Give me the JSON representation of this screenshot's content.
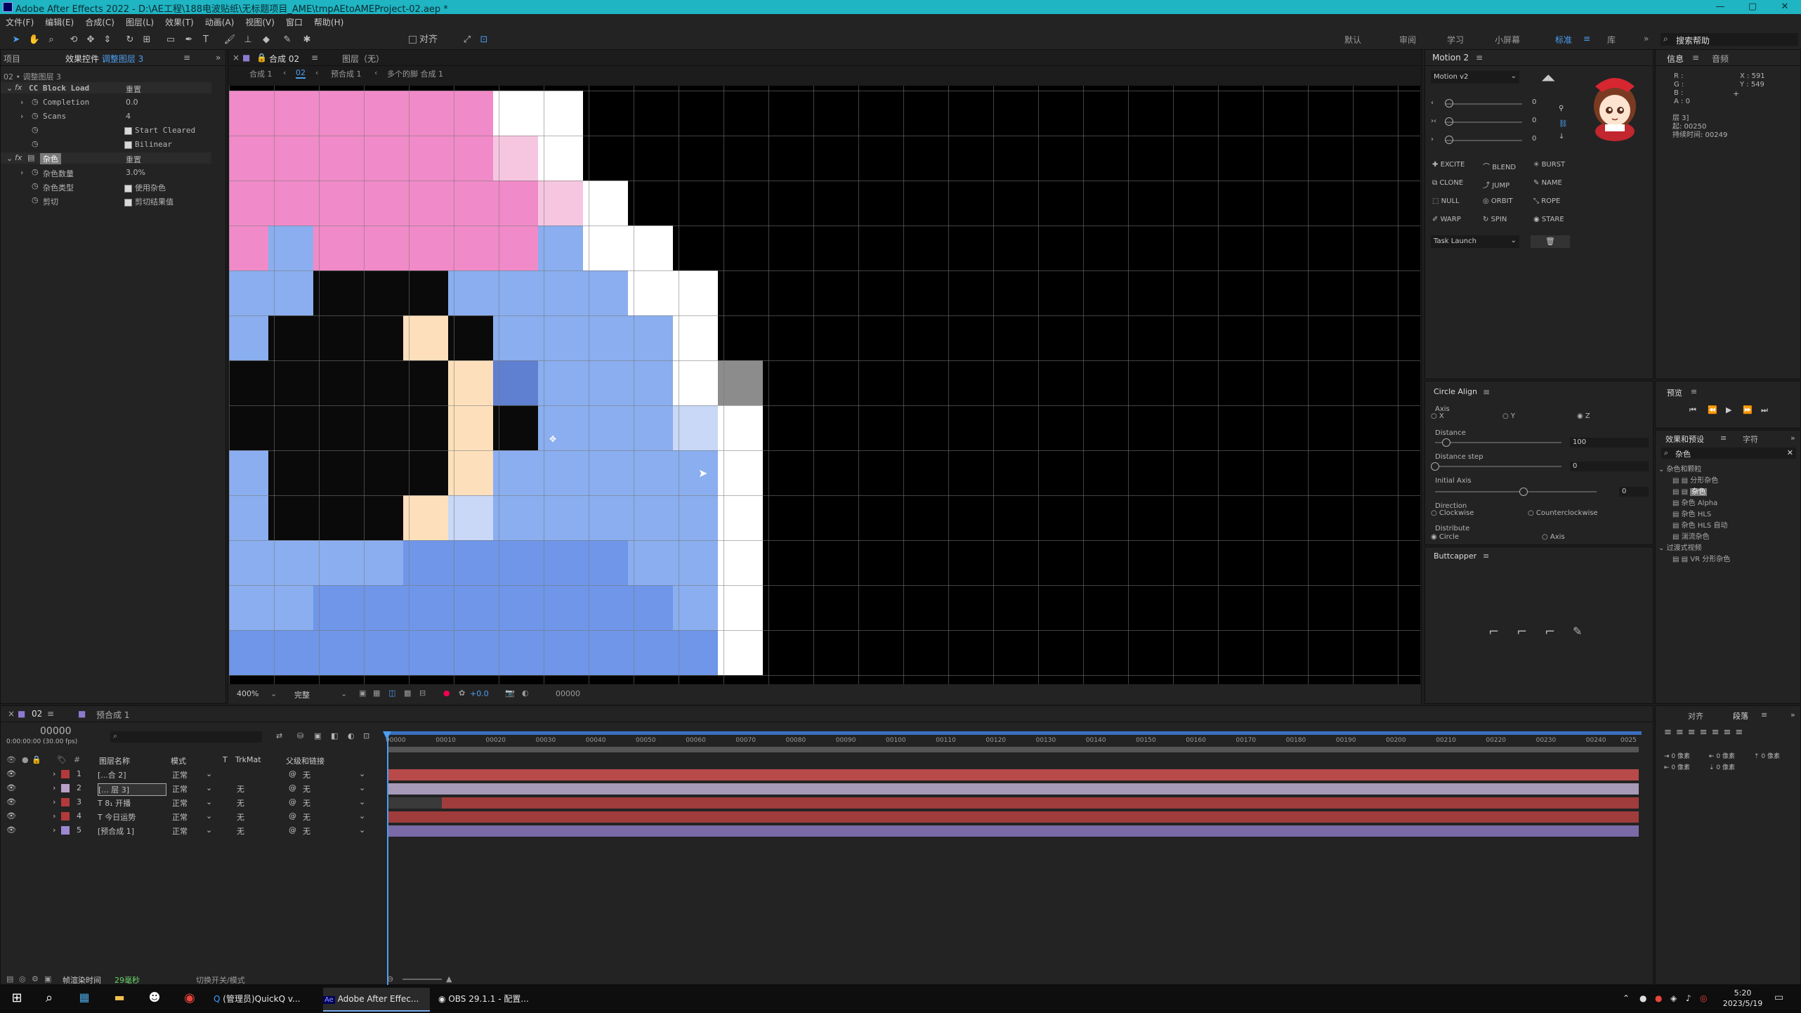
{
  "window": {
    "title": "Adobe After Effects 2022 - D:\\AE工程\\188电波贴纸\\无标题项目_AME\\tmpAEtoAMEProject-02.aep *",
    "controls": [
      "—",
      "▢",
      "✕"
    ]
  },
  "menu": [
    "文件(F)",
    "编辑(E)",
    "合成(C)",
    "图层(L)",
    "效果(T)",
    "动画(A)",
    "视图(V)",
    "窗口",
    "帮助(H)"
  ],
  "toolbar": {
    "align_label": "对齐",
    "workspaces": [
      "默认",
      "审阅",
      "学习",
      "小屏幕",
      "标准",
      "库"
    ],
    "active_workspace": "标准",
    "search_placeholder": "搜索帮助"
  },
  "left_panel": {
    "tab_project": "项目",
    "tab_effects": "效果控件",
    "tab_effects_target": "调整图层 3",
    "subtitle": "02 • 调整图层 3",
    "effect1": {
      "name": "CC Block Load",
      "reset": "重置",
      "props": [
        {
          "name": "Completion",
          "value": "0.0"
        },
        {
          "name": "Scans",
          "value": "4"
        }
      ],
      "checks": [
        "Start Cleared",
        "Bilinear"
      ]
    },
    "effect2": {
      "name": "杂色",
      "reset": "重置",
      "props": [
        {
          "name": "杂色数量",
          "value": "3.0%"
        },
        {
          "name": "杂色类型",
          "value": "使用杂色"
        },
        {
          "name": "剪切",
          "value": "剪切结果值"
        }
      ]
    }
  },
  "comp_panel": {
    "tab_label": "合成 02",
    "layer_tab": "图层（无）",
    "breadcrumbs": [
      "合成 1",
      "02",
      "预合成 1",
      "多个的脚 合成 1"
    ],
    "zoom": "400%",
    "quality": "完整",
    "exposure": "+0.0",
    "timecode": "00000"
  },
  "motion": {
    "title": "Motion 2",
    "version": "Motion v2",
    "sliders": [
      "0",
      "0",
      "0"
    ],
    "buttons": [
      "EXCITE",
      "BLEND",
      "BURST",
      "CLONE",
      "JUMP",
      "NAME",
      "NULL",
      "ORBIT",
      "ROPE",
      "WARP",
      "SPIN",
      "STARE"
    ],
    "task": "Task Launch"
  },
  "circle_align": {
    "title": "Circle Align",
    "axis_label": "Axis",
    "axis_options": [
      "X",
      "Y",
      "Z"
    ],
    "distance_label": "Distance",
    "distance_value": "100",
    "distance_step_label": "Distance step",
    "distance_step_value": "0",
    "initial_axis_label": "Initial Axis",
    "initial_axis_value": "0",
    "direction_label": "Direction",
    "direction_options": [
      "Clockwise",
      "Counterclockwise"
    ],
    "distribute_label": "Distribute",
    "distribute_options": [
      "Circle",
      "Axis"
    ]
  },
  "buttcapper": {
    "title": "Buttcapper"
  },
  "info": {
    "tab_info": "信息",
    "tab_audio": "音频",
    "rgb": [
      "R :",
      "G :",
      "B :",
      "A : 0"
    ],
    "xy": [
      "X : 591",
      "Y : 549"
    ],
    "layer_lines": [
      "层 3]",
      "起: 00250",
      "持续时间: 00249"
    ]
  },
  "preview": {
    "title": "预览"
  },
  "effects_presets": {
    "tab1": "效果和预设",
    "tab2": "字符",
    "search_value": "杂色",
    "groups": [
      {
        "name": "杂色和颗粒",
        "items": [
          "分形杂色",
          "杂色",
          "杂色 Alpha",
          "杂色 HLS",
          "杂色 HLS 自动",
          "湍流杂色"
        ]
      },
      {
        "name": "过渡式视频",
        "items": [
          "VR 分形杂色"
        ]
      }
    ]
  },
  "align_panel": {
    "tab_align": "对齐",
    "tab_paragraph": "段落",
    "values": [
      "0 像素",
      "0 像素",
      "0 像素",
      "0 像素",
      "0 像素"
    ]
  },
  "timeline": {
    "tab_comp": "02",
    "tab_precomp": "预合成 1",
    "timecode": "00000",
    "fps": "0:00:00:00 (30.00 fps)",
    "headers": {
      "name": "图层名称",
      "mode": "模式",
      "t": "T",
      "trkmat": "TrkMat",
      "parent": "父级和链接"
    },
    "ruler": [
      "00000",
      "00010",
      "00020",
      "00030",
      "00040",
      "00050",
      "00060",
      "00070",
      "00080",
      "00090",
      "00100",
      "00110",
      "00120",
      "00130",
      "00140",
      "00150",
      "00160",
      "00170",
      "00180",
      "00190",
      "00200",
      "00210",
      "00220",
      "00230",
      "00240",
      "0025"
    ],
    "layers": [
      {
        "num": "1",
        "name": "[...合 2]",
        "mode": "正常",
        "trkmat": "",
        "parent": "无",
        "label": "#b33a3a",
        "bar": "#b84a4a"
      },
      {
        "num": "2",
        "name": "[... 层 3]",
        "mode": "正常",
        "trkmat": "无",
        "parent": "无",
        "label": "#b8a0c8",
        "bar": "#a79ab8"
      },
      {
        "num": "3",
        "name": "T 8₁ 开播",
        "mode": "正常",
        "trkmat": "无",
        "parent": "无",
        "label": "#b33a3a",
        "bar": "#a03c3c"
      },
      {
        "num": "4",
        "name": "T 今日运势",
        "mode": "正常",
        "trkmat": "无",
        "parent": "无",
        "label": "#b33a3a",
        "bar": "#a03c3c"
      },
      {
        "num": "5",
        "name": "[预合成 1]",
        "mode": "正常",
        "trkmat": "无",
        "parent": "无",
        "label": "#9b88d0",
        "bar": "#7a6aa8"
      }
    ],
    "footer_left": "帧渲染时间",
    "footer_ms": "29毫秒",
    "footer_toggle": "切换开关/模式"
  },
  "taskbar": {
    "apps": [
      "(管理员)QuickQ v...",
      "Adobe After Effec...",
      "OBS 29.1.1 - 配置..."
    ],
    "time": "5:20",
    "date": "2023/5/19"
  },
  "canvas_colors": {
    "pink": "#f18ac8",
    "light_pink": "#f6c6e0",
    "blue": "#8aaeef",
    "mid_blue": "#6f96e8",
    "dark_blue": "#5f7fd0",
    "white": "#ffffff",
    "peach": "#fde0bb",
    "black": "#0a0a0a",
    "gray": "#8c8c8c",
    "pale_blue": "#c8d8f6"
  }
}
